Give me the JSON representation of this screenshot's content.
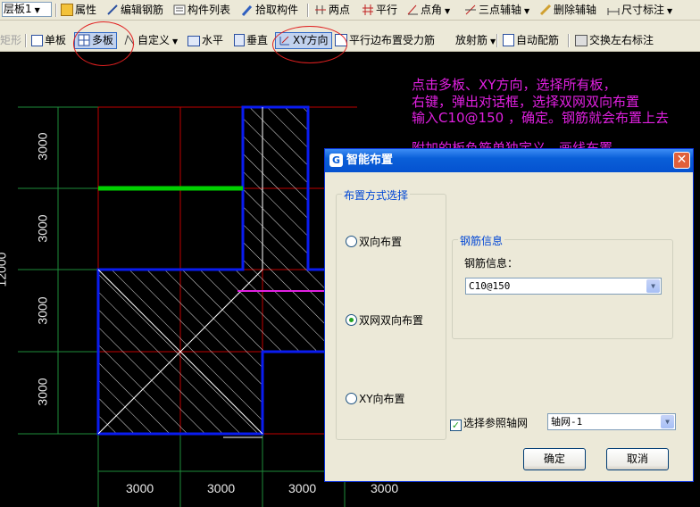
{
  "toolbar1": {
    "layer": "层板1",
    "props": "属性",
    "edit_rebar": "编辑钢筋",
    "component_list": "构件列表",
    "pick_component": "拾取构件",
    "two_points": "两点",
    "parallel": "平行",
    "point_angle": "点角",
    "three_point_axis": "三点辅轴",
    "delete_axis": "删除辅轴",
    "dim_mark": "尺寸标注"
  },
  "toolbar2": {
    "rect": "矩形",
    "single": "单板",
    "multi": "多板",
    "custom": "自定义",
    "horizontal": "水平",
    "vertical": "垂直",
    "xy": "XY方向",
    "parallel_edge": "平行边布置受力筋",
    "radial": "放射筋",
    "auto_rebar": "自动配筋",
    "swap_lr": "交换左右标注"
  },
  "notes": {
    "line1": "点击多板、XY方向，选择所有板，",
    "line2": "右键，弹出对话框，选择双网双向布置",
    "line3": "输入C10@150 ，确定。钢筋就会布置上去",
    "line4": "附加的板负筋单独定义，画线布置"
  },
  "dims": {
    "left": [
      "3000",
      "3000",
      "3000",
      "3000"
    ],
    "total": "12000",
    "bottom": [
      "3000",
      "3000",
      "3000",
      "3000"
    ]
  },
  "dialog": {
    "title": "智能布置",
    "group_mode": "布置方式选择",
    "opt_bidirectional": "双向布置",
    "opt_double_net": "双网双向布置",
    "opt_xy": "XY向布置",
    "selected": "双网双向布置",
    "group_rebar": "钢筋信息",
    "rebar_label": "钢筋信息：",
    "rebar_value": "C10@150",
    "chk_ref_axis": "选择参照轴网",
    "axis_value": "轴网-1",
    "ok": "确定",
    "cancel": "取消"
  },
  "colors": {
    "grid_red": "#c00000",
    "grid_green": "#1e8c3a",
    "slab_blue": "#0a1cf0",
    "rebar_green": "#00d000",
    "note_magenta": "#e020e0"
  }
}
